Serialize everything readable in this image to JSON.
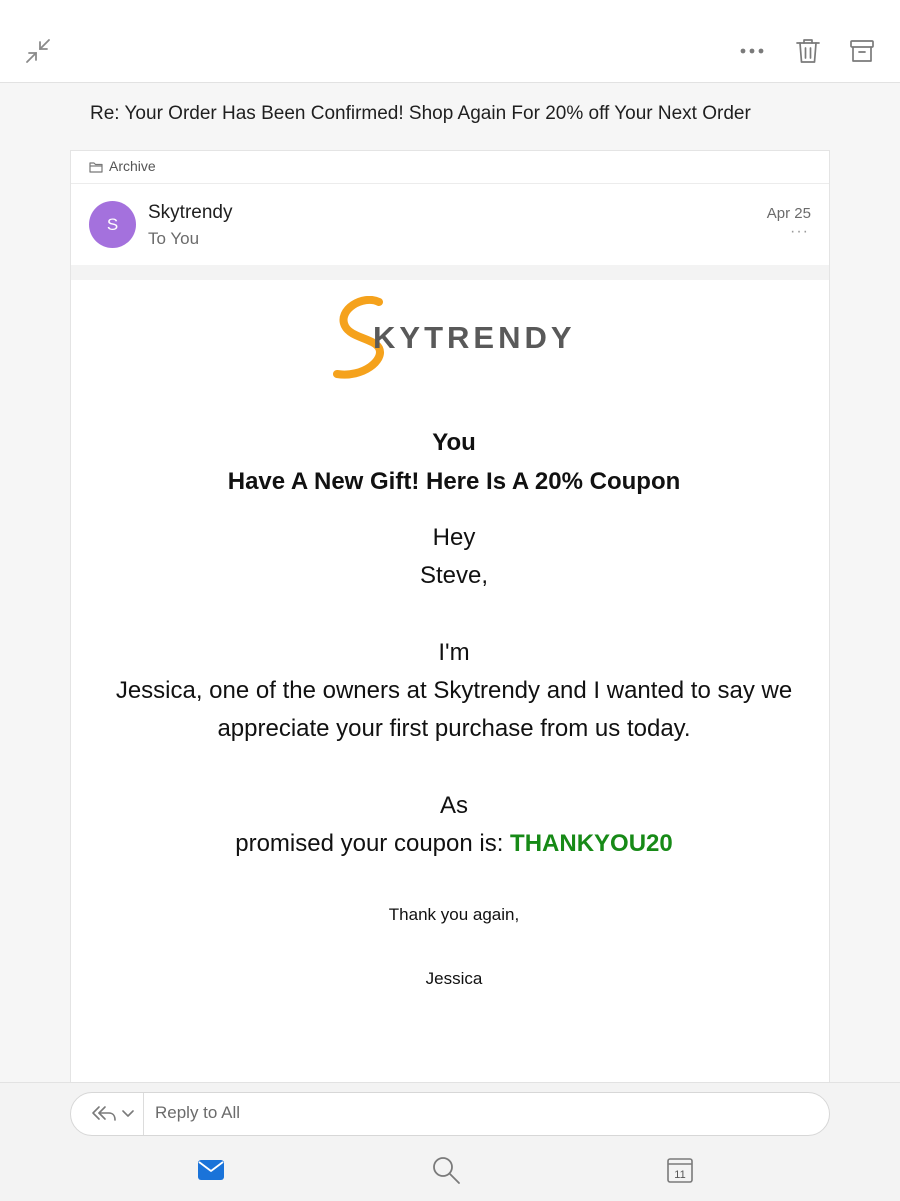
{
  "subject": "Re: Your Order Has Been Confirmed! Shop Again For 20% off Your Next Order",
  "folder": "Archive",
  "message": {
    "avatar_initial": "S",
    "sender": "Skytrendy",
    "recipient": "To You",
    "date": "Apr 25",
    "more_label": "···"
  },
  "email_body": {
    "logo_text": "KYTRENDY",
    "logo_mark": "S",
    "heading_line1": "You",
    "heading_line2": "Have A New Gift! Here Is A 20% Coupon",
    "greeting_line1": "Hey",
    "greeting_line2": "Steve,",
    "para_line1": "I'm",
    "para_line2": "Jessica, one of the owners at Skytrendy and I wanted to say we",
    "para_line3": "appreciate your first purchase from us today.",
    "coupon_line1": "As",
    "coupon_prefix": "promised your coupon is: ",
    "coupon_code": "THANKYOU20",
    "thanks": "Thank you again,",
    "signoff": "Jessica"
  },
  "reply": {
    "placeholder": "Reply to All"
  },
  "bottom_nav": {
    "calendar_day": "11"
  },
  "icons": {
    "toolbar": [
      "collapse-icon",
      "more-icon",
      "trash-icon",
      "archive-icon"
    ],
    "nav": [
      "mail-icon",
      "search-icon",
      "calendar-icon"
    ]
  },
  "colors": {
    "avatar": "#a471dd",
    "coupon_code": "#178a17",
    "logo_orange": "#f5a21c",
    "mail_active": "#1a73d9"
  }
}
